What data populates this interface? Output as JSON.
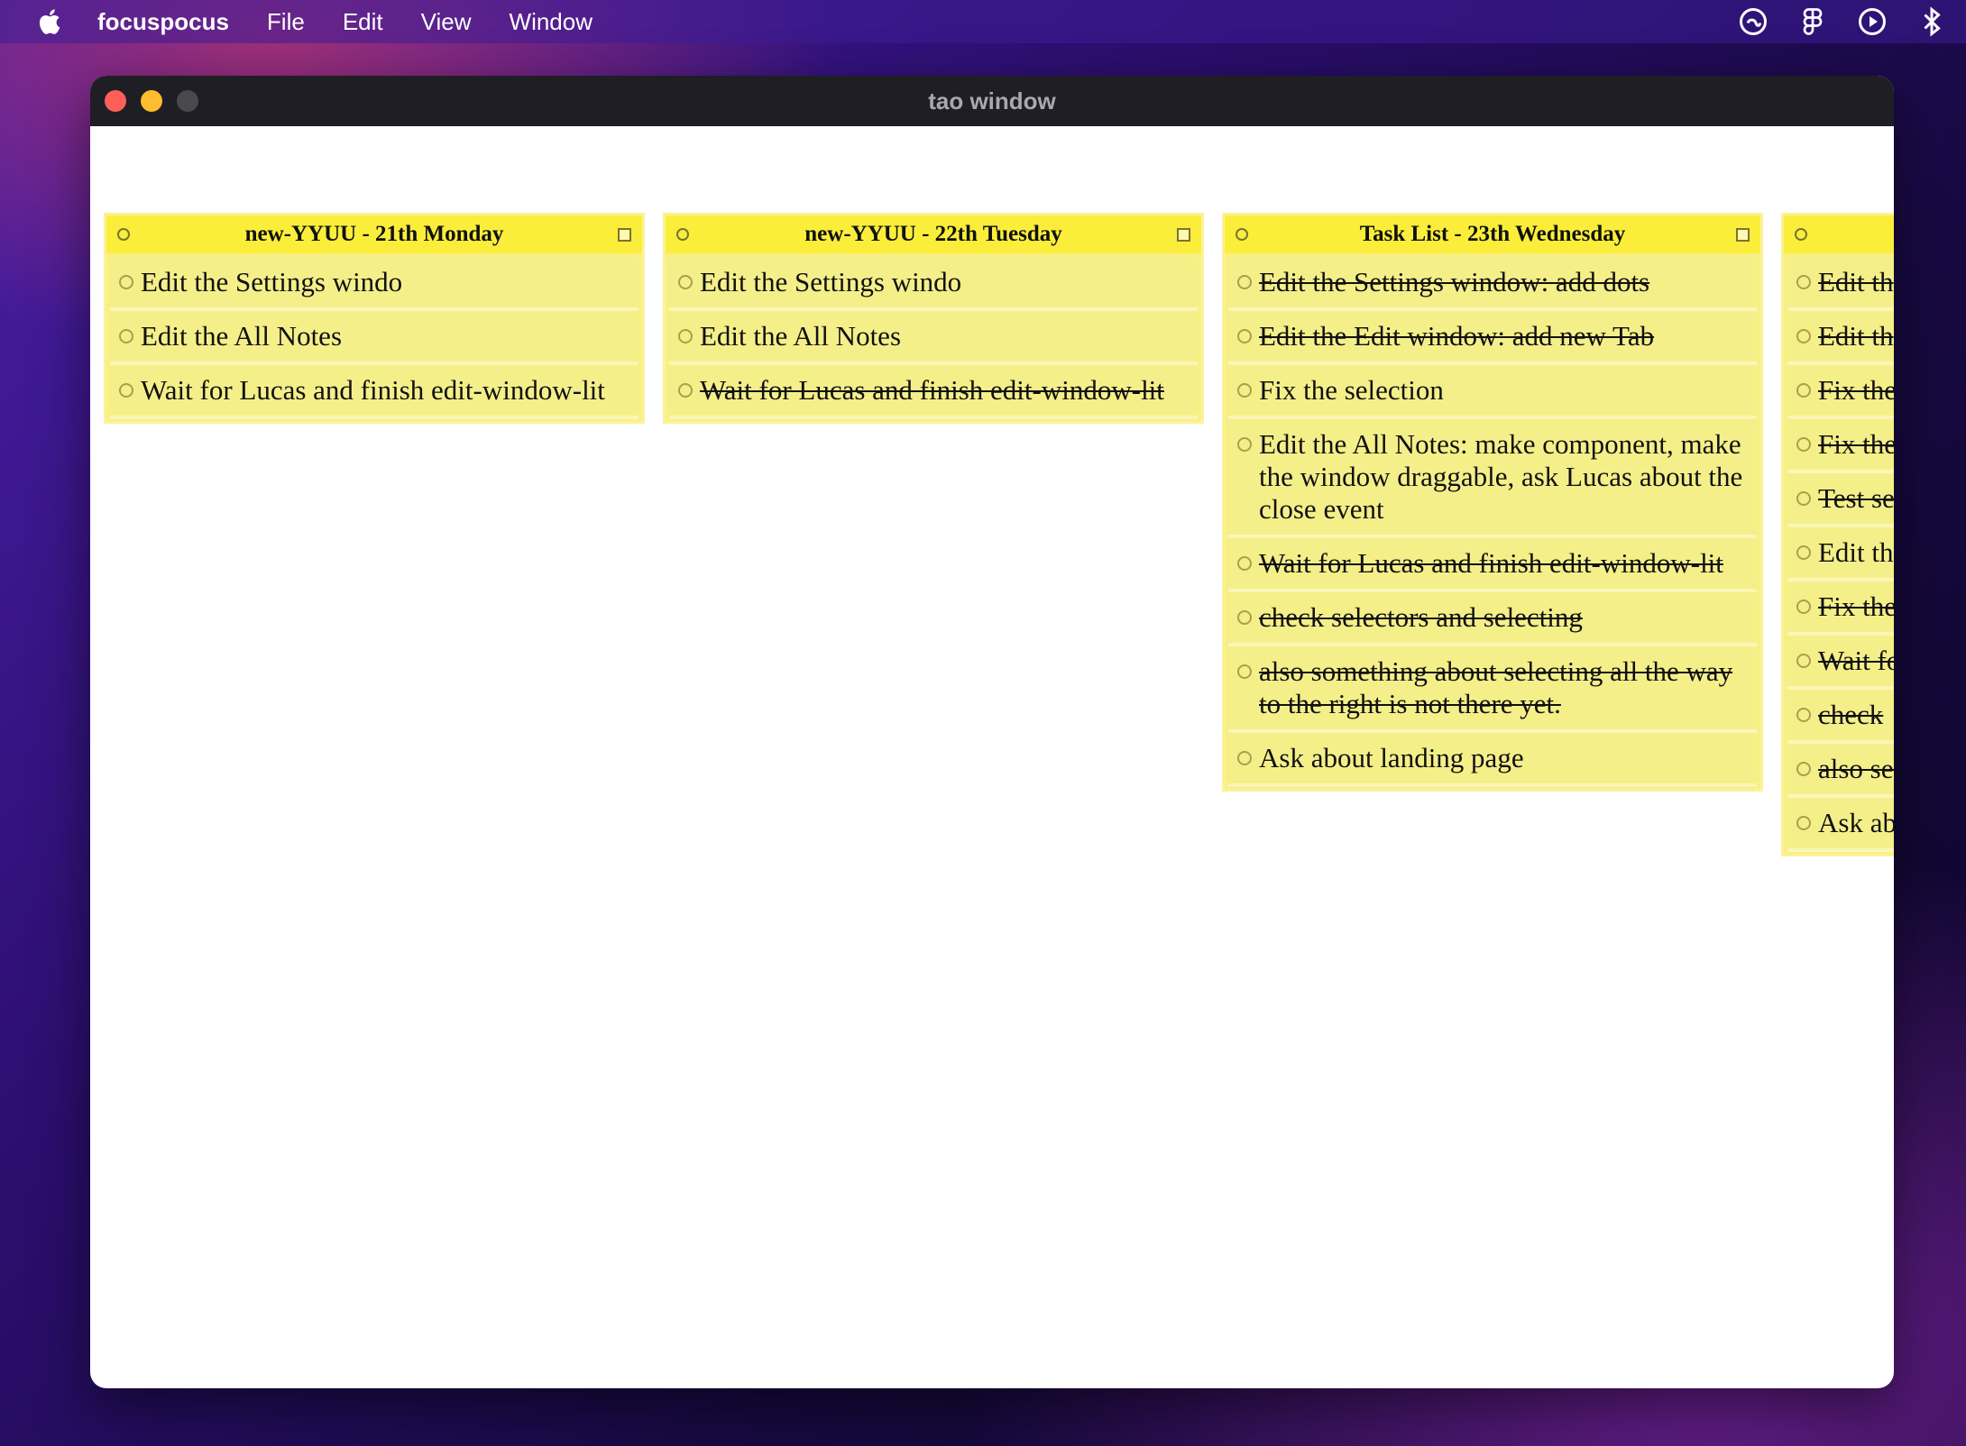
{
  "menubar": {
    "app_name": "focuspocus",
    "items": [
      "File",
      "Edit",
      "View",
      "Window"
    ],
    "status_icons": [
      "creative-cloud-icon",
      "figma-icon",
      "play-icon",
      "bluetooth-icon"
    ]
  },
  "window": {
    "title": "tao window"
  },
  "lists": [
    {
      "title": "new-YYUU - 21th Monday",
      "tasks": [
        {
          "text": "Edit the Settings windo",
          "done": false
        },
        {
          "text": "Edit the All Notes",
          "done": false
        },
        {
          "text": "Wait for Lucas and finish edit-window-lit",
          "done": false
        }
      ]
    },
    {
      "title": "new-YYUU - 22th Tuesday",
      "tasks": [
        {
          "text": "Edit the Settings windo",
          "done": false
        },
        {
          "text": "Edit the All Notes",
          "done": false
        },
        {
          "text": "Wait for Lucas and finish edit-window-lit",
          "done": true
        }
      ]
    },
    {
      "title": "Task List - 23th Wednesday",
      "tasks": [
        {
          "text": "Edit the Settings window: add dots",
          "done": true
        },
        {
          "text": "Edit the Edit window: add new Tab",
          "done": true
        },
        {
          "text": "Fix the selection",
          "done": false
        },
        {
          "text": "Edit the All Notes: make component, make the window draggable, ask Lucas about the close event",
          "done": false
        },
        {
          "text": "Wait for Lucas and finish edit-window-lit",
          "done": true
        },
        {
          "text": "check selectors and selecting",
          "done": true
        },
        {
          "text": "also something about selecting all the way to the right is not there yet.",
          "done": true
        },
        {
          "text": "Ask about landing page",
          "done": false
        }
      ]
    },
    {
      "title": "",
      "tasks": [
        {
          "text": "Edit th",
          "done": true
        },
        {
          "text": "Edit th",
          "done": true
        },
        {
          "text": "Fix the",
          "done": true
        },
        {
          "text": "Fix the one is",
          "done": true
        },
        {
          "text": "Test se",
          "done": true
        },
        {
          "text": "Edit th make t about",
          "done": false
        },
        {
          "text": "Fix the ‘ the ta",
          "done": true
        },
        {
          "text": "Wait fo",
          "done": true
        },
        {
          "text": "check",
          "done": true
        },
        {
          "text": "also se to the",
          "done": true
        },
        {
          "text": "Ask ab",
          "done": false
        }
      ]
    }
  ]
}
